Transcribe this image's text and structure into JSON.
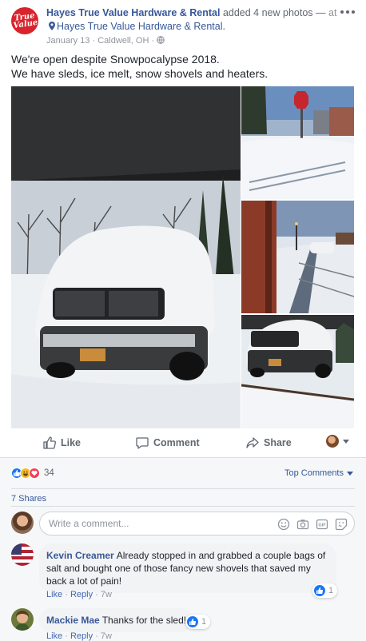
{
  "post": {
    "logo_text": "True\nValue",
    "page_name": "Hayes True Value Hardware & Rental",
    "action_text": "added 4 new photos —",
    "at_text": "at",
    "location": "Hayes True Value Hardware & Rental.",
    "date": "January 13",
    "city": "Caldwell, OH",
    "message_line1": "We're open despite Snowpocalypse 2018.",
    "message_line2": "We have sleds, ice melt, snow shovels and heaters."
  },
  "actions": {
    "like": "Like",
    "comment": "Comment",
    "share": "Share"
  },
  "feedback": {
    "reaction_count": "34",
    "top_comments_label": "Top Comments",
    "shares_label": "7 Shares",
    "write_placeholder": "Write a comment..."
  },
  "comments": [
    {
      "author": "Kevin Creamer",
      "text": "Already stopped in and grabbed a couple bags of salt and bought one of those fancy new shovels that saved my back a lot of pain!",
      "like_label": "Like",
      "reply_label": "Reply",
      "time": "7w",
      "reaction_count": "1"
    },
    {
      "author": "Mackie Mae",
      "text": "Thanks for the sled!",
      "like_label": "Like",
      "reply_label": "Reply",
      "time": "7w",
      "reaction_count": "1"
    }
  ],
  "icons": [
    "more-options-icon",
    "location-pin-icon",
    "globe-icon",
    "like-icon",
    "comment-icon",
    "share-icon",
    "camera-icon",
    "gif-icon",
    "sticker-icon",
    "emoji-icon"
  ],
  "colors": {
    "link_blue": "#365899",
    "logo_red": "#d9232d",
    "like_blue": "#1877f2",
    "feedback_bg": "#f6f7f9"
  }
}
